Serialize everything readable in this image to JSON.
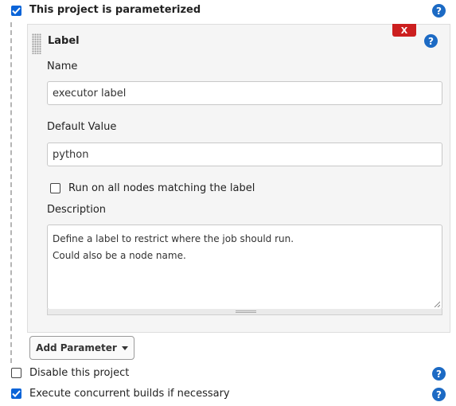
{
  "parameterized": {
    "label": "This project is parameterized",
    "checked": true
  },
  "parameter": {
    "title": "Label",
    "delete_label": "X",
    "name": {
      "label": "Name",
      "value": "executor label"
    },
    "default_value": {
      "label": "Default Value",
      "value": "python"
    },
    "all_nodes": {
      "label": "Run on all nodes matching the label",
      "checked": false
    },
    "description": {
      "label": "Description",
      "lines": [
        "Define a label to restrict where the job should run.",
        "Could also be a node name."
      ]
    }
  },
  "add_parameter": {
    "label": "Add Parameter"
  },
  "disable_project": {
    "label": "Disable this project",
    "checked": false
  },
  "concurrent_builds": {
    "label": "Execute concurrent builds if necessary",
    "checked": true
  },
  "help_icon_text": "?",
  "colors": {
    "accent": "#0a64d8",
    "help": "#1c6ac4",
    "delete": "#cc1f1f"
  }
}
